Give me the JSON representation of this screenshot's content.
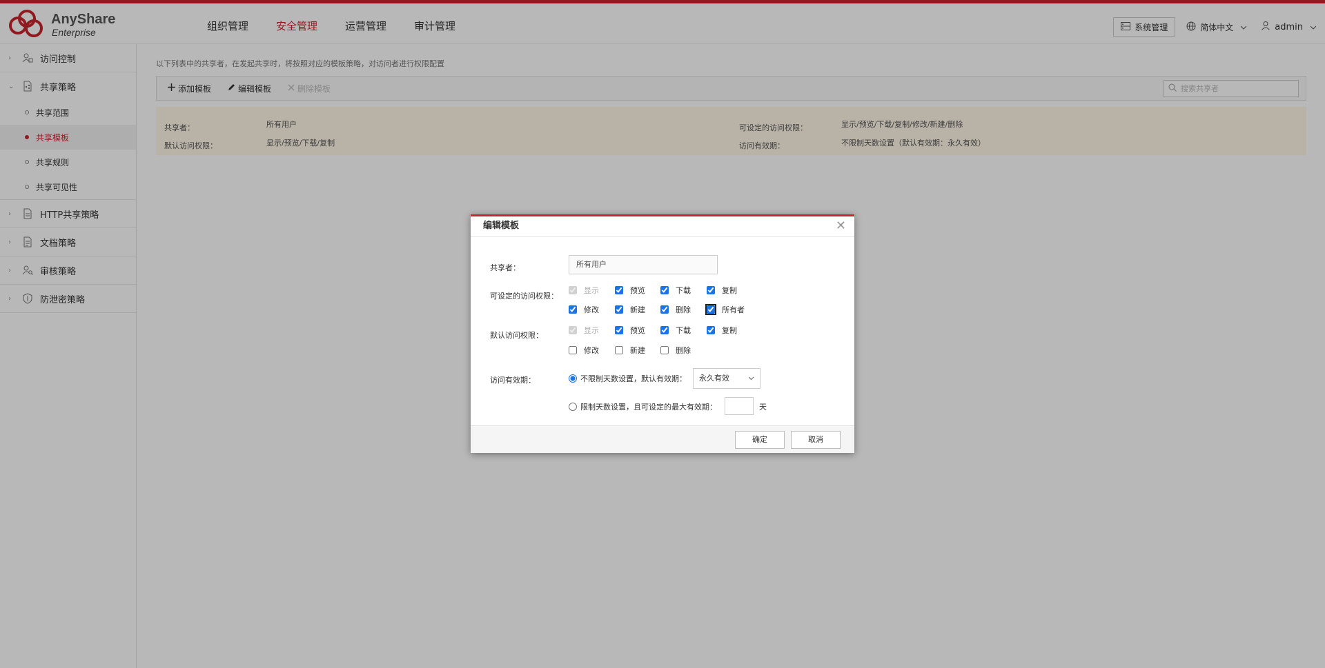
{
  "header": {
    "brand": "AnyShare",
    "brand_sub": "Enterprise",
    "nav": [
      {
        "label": "组织管理"
      },
      {
        "label": "安全管理"
      },
      {
        "label": "运营管理"
      },
      {
        "label": "审计管理"
      }
    ],
    "system_btn": "系统管理",
    "language": "简体中文",
    "user": "admin",
    "accent": "#c9252f"
  },
  "sidebar": {
    "groups": [
      {
        "label": "访问控制"
      },
      {
        "label": "共享策略",
        "children": [
          {
            "label": "共享范围"
          },
          {
            "label": "共享模板"
          },
          {
            "label": "共享规则"
          },
          {
            "label": "共享可见性"
          }
        ]
      },
      {
        "label": "HTTP共享策略"
      },
      {
        "label": "文档策略"
      },
      {
        "label": "审核策略"
      },
      {
        "label": "防泄密策略"
      }
    ]
  },
  "main": {
    "description": "以下列表中的共享者，在发起共享时，将按照对应的模板策略，对访问者进行权限配置",
    "toolbar": {
      "add": "添加模板",
      "edit": "编辑模板",
      "delete": "删除模板",
      "search_placeholder": "搜索共享者"
    },
    "row": {
      "sharer_label": "共享者：",
      "sharer_value": "所有用户",
      "default_perm_label": "默认访问权限：",
      "default_perm_value": "显示/预览/下载/复制",
      "settable_perm_label": "可设定的访问权限：",
      "settable_perm_value": "显示/预览/下载/复制/修改/新建/删除",
      "validity_label": "访问有效期：",
      "validity_value": "不限制天数设置（默认有效期：永久有效）"
    }
  },
  "dialog": {
    "title": "编辑模板",
    "sharer_label": "共享者：",
    "sharer_value": "所有用户",
    "settable_label": "可设定的访问权限：",
    "settable": {
      "display": "显示",
      "preview": "预览",
      "download": "下载",
      "copy": "复制",
      "modify": "修改",
      "create": "新建",
      "delete": "删除",
      "owner": "所有者"
    },
    "default_label": "默认访问权限：",
    "default": {
      "display": "显示",
      "preview": "预览",
      "download": "下载",
      "copy": "复制",
      "modify": "修改",
      "create": "新建",
      "delete": "删除"
    },
    "validity_label": "访问有效期：",
    "unlimited_option": "不限制天数设置，默认有效期：",
    "unlimited_select": "永久有效",
    "limited_option": "限制天数设置，且可设定的最大有效期：",
    "day_unit": "天",
    "ok": "确定",
    "cancel": "取消"
  }
}
